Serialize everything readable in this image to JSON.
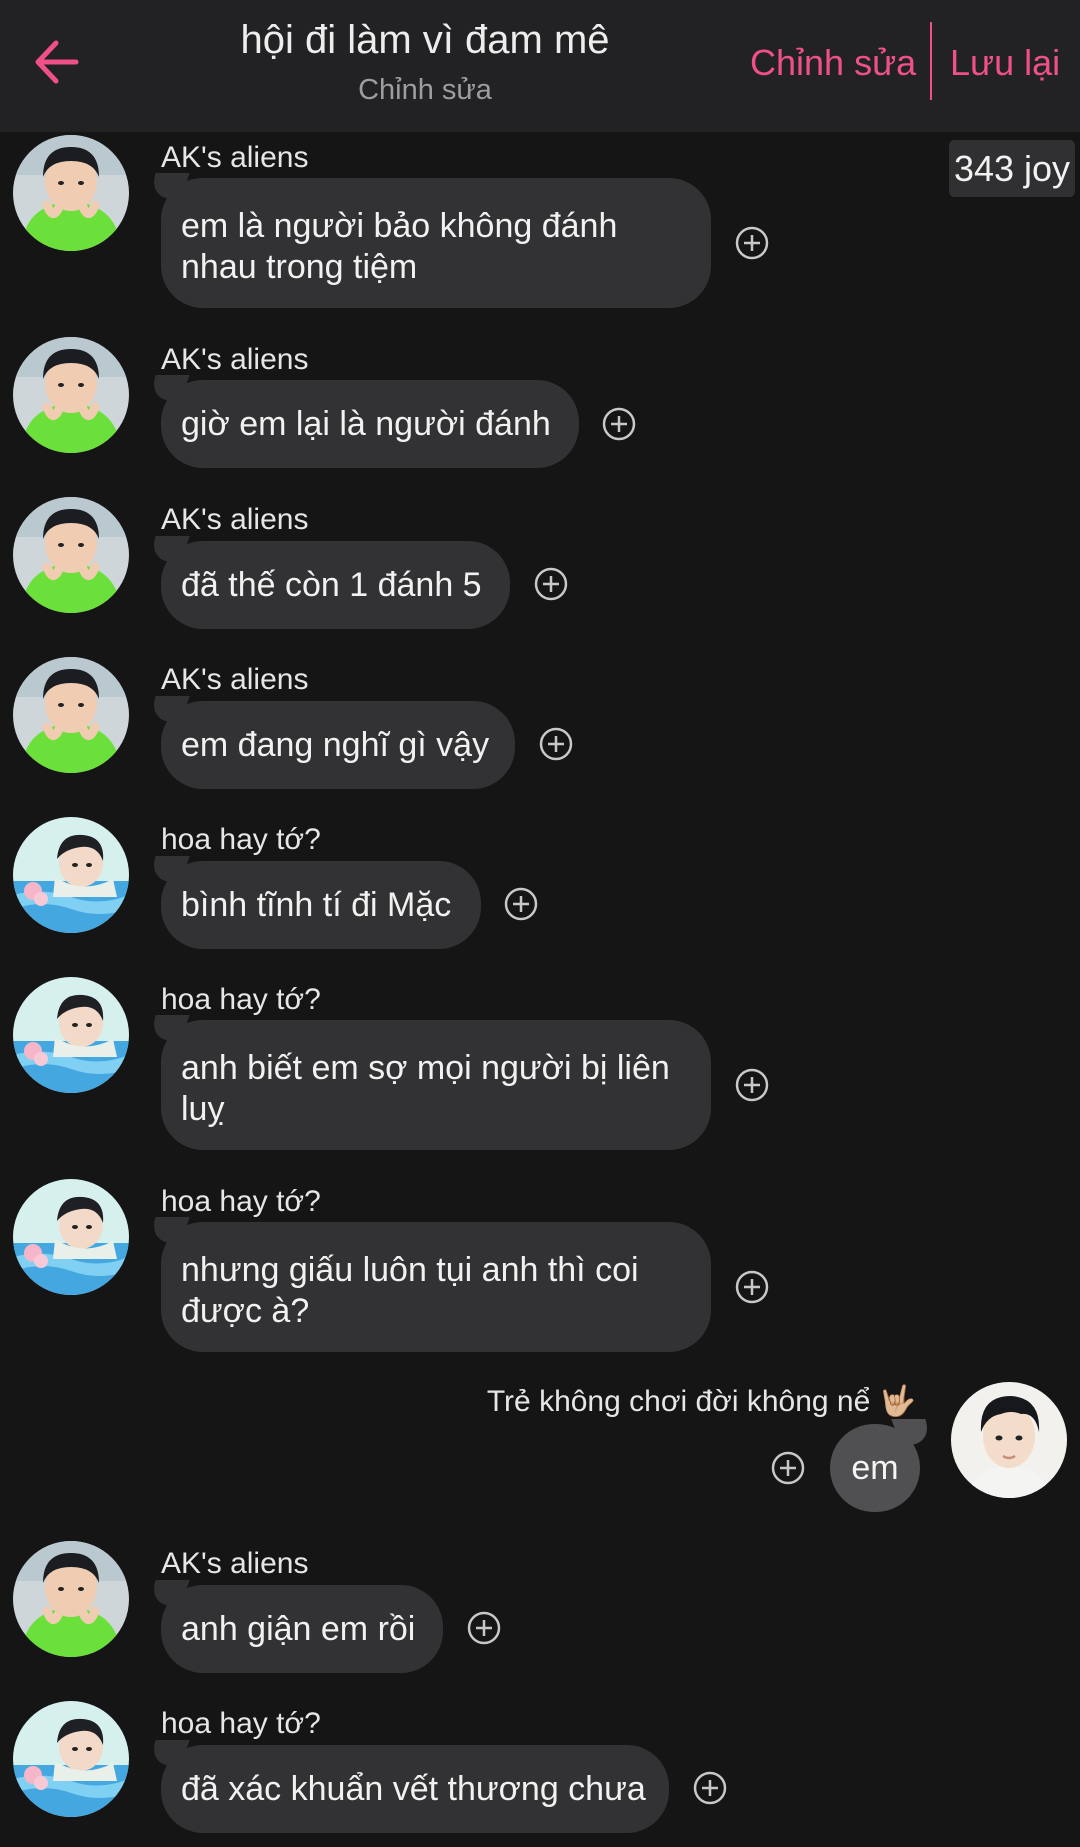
{
  "header": {
    "title": "hội đi làm vì đam mê",
    "subtitle": "Chỉnh sửa",
    "edit_label": "Chỉnh sửa",
    "save_label": "Lưu lại",
    "accent_color": "#f0508a"
  },
  "badge": {
    "text": "343 joy"
  },
  "messages": [
    {
      "sender": "AK's aliens",
      "text": "em là người bảo không đánh\nnhau trong tiệm",
      "avatar": "green-hoodie-avatar"
    },
    {
      "sender": "AK's aliens",
      "text": "giờ em lại là người đánh",
      "avatar": "green-hoodie-avatar"
    },
    {
      "sender": "AK's aliens",
      "text": "đã thế còn 1 đánh 5",
      "avatar": "green-hoodie-avatar"
    },
    {
      "sender": "AK's aliens",
      "text": "em đang nghĩ gì vậy",
      "avatar": "green-hoodie-avatar"
    },
    {
      "sender": "hoa hay tớ?",
      "text": "bình tĩnh tí đi Mặc",
      "avatar": "pool-avatar"
    },
    {
      "sender": "hoa hay tớ?",
      "text": "anh biết em sợ mọi người bị liên\nluỵ",
      "avatar": "pool-avatar"
    },
    {
      "sender": "hoa hay tớ?",
      "text": "nhưng giấu luôn tụi anh thì coi\nđược à?",
      "avatar": "pool-avatar"
    },
    {
      "sender": "AK's aliens",
      "text": "anh giận em rồi",
      "avatar": "green-hoodie-avatar"
    },
    {
      "sender": "hoa hay tớ?",
      "text": "đã xác khuẩn vết thương chưa",
      "avatar": "pool-avatar"
    }
  ],
  "outgoing": {
    "sender": "Trẻ không chơi đời không nể",
    "emoji": "🤟🏼",
    "text": "em",
    "avatar": "portrait-avatar"
  }
}
